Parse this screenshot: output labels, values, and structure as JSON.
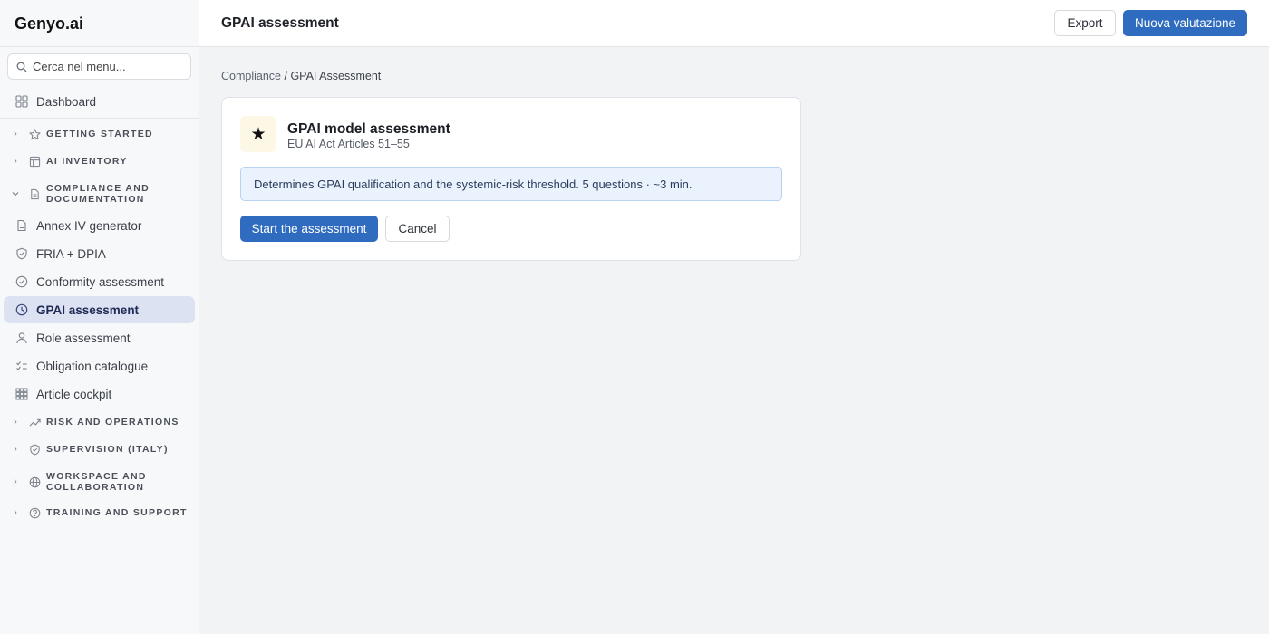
{
  "app": {
    "brand": "Genyo.ai"
  },
  "sidebar": {
    "search_placeholder": "Cerca nel menu...",
    "dashboard": "Dashboard",
    "sections": {
      "getting_started": "GETTING STARTED",
      "ai_inventory": "AI INVENTORY",
      "compliance_1": "COMPLIANCE AND",
      "compliance_2": "DOCUMENTATION",
      "risk": "RISK AND OPERATIONS",
      "supervision": "SUPERVISION (ITALY)",
      "workspace_1": "WORKSPACE AND",
      "workspace_2": "COLLABORATION",
      "training": "TRAINING AND SUPPORT"
    },
    "items": [
      {
        "label": "Annex IV generator",
        "icon": "document-icon"
      },
      {
        "label": "FRIA + DPIA",
        "icon": "shield-check-icon"
      },
      {
        "label": "Conformity assessment",
        "icon": "check-circle-icon"
      },
      {
        "label": "GPAI assessment",
        "icon": "clock-icon",
        "active": true
      },
      {
        "label": "Role assessment",
        "icon": "user-icon"
      },
      {
        "label": "Obligation catalogue",
        "icon": "checklist-icon"
      },
      {
        "label": "Article cockpit",
        "icon": "grid-icon"
      }
    ]
  },
  "header": {
    "title": "GPAI assessment",
    "export_label": "Export",
    "new_label": "Nuova valutazione"
  },
  "breadcrumb": {
    "parent": "Compliance",
    "separator": " / ",
    "current": "GPAI Assessment"
  },
  "card": {
    "title": "GPAI model assessment",
    "subtitle": "EU AI Act Articles 51–55",
    "info": "Determines GPAI qualification and the systemic-risk threshold. 5 questions · ~3 min.",
    "start_label": "Start the assessment",
    "cancel_label": "Cancel"
  },
  "colors": {
    "accent": "#2f6cbf",
    "active_bg": "#dde2f2",
    "info_bg": "#eaf2fd"
  }
}
